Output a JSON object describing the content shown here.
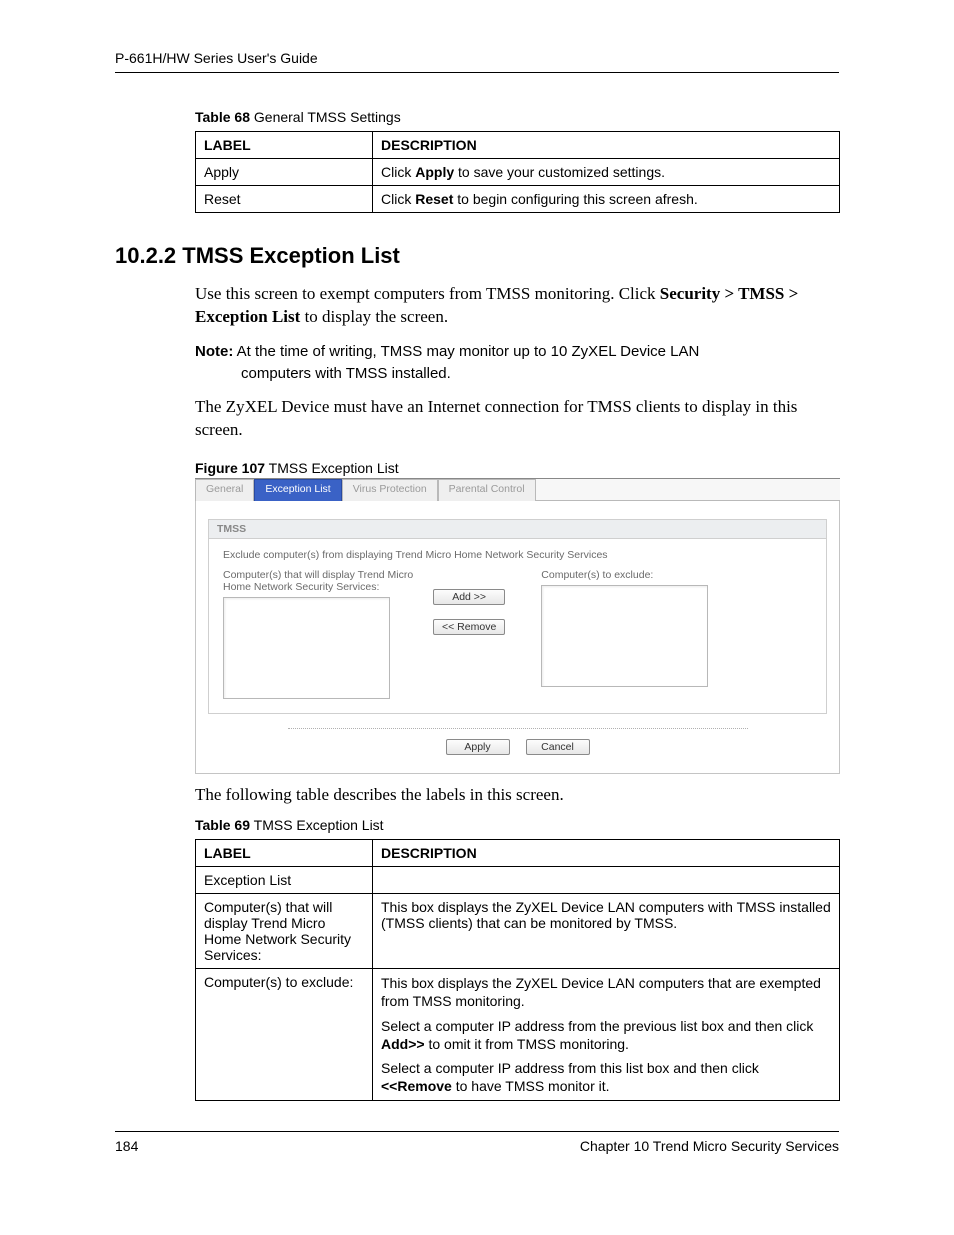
{
  "running_head": "P-661H/HW Series User's Guide",
  "table68": {
    "caption_bold": "Table 68",
    "caption_rest": "   General TMSS Settings",
    "h_label": "LABEL",
    "h_desc": "DESCRIPTION",
    "r1_label": "Apply",
    "r1_pre": "Click ",
    "r1_bold": "Apply",
    "r1_post": " to save your customized settings.",
    "r2_label": "Reset",
    "r2_pre": "Click ",
    "r2_bold": "Reset",
    "r2_post": " to begin configuring this screen afresh."
  },
  "section": {
    "heading": "10.2.2  TMSS Exception List",
    "p1_a": "Use this screen to exempt computers from TMSS monitoring. Click ",
    "p1_b": "Security > TMSS > Exception List",
    "p1_c": " to display the screen.",
    "note_bold": "Note:",
    "note_rest_line1": " At the time of writing, TMSS may monitor up to 10 ZyXEL Device LAN",
    "note_rest_line2": "computers with TMSS installed.",
    "p2": "The ZyXEL Device must have an Internet connection for TMSS clients to display in this screen.",
    "p3": "The following table describes the labels in this screen."
  },
  "fig107": {
    "caption_bold": "Figure 107",
    "caption_rest": "   TMSS Exception List",
    "tabs": {
      "general": "General",
      "exception": "Exception List",
      "virus": "Virus Protection",
      "parental": "Parental Control"
    },
    "panel_title": "TMSS",
    "instr": "Exclude computer(s) from displaying Trend Micro Home Network Security Services",
    "left_label_l1": "Computer(s) that will display Trend Micro",
    "left_label_l2": "Home Network Security Services:",
    "right_label": "Computer(s) to exclude:",
    "btn_add": "Add >>",
    "btn_remove": "<< Remove",
    "btn_apply": "Apply",
    "btn_cancel": "Cancel"
  },
  "table69": {
    "caption_bold": "Table 69",
    "caption_rest": "   TMSS Exception List",
    "h_label": "LABEL",
    "h_desc": "DESCRIPTION",
    "r1_label": "Exception List",
    "r2_label": "Computer(s) that will display Trend Micro Home Network Security Services:",
    "r2_desc": "This box displays the ZyXEL Device LAN computers with TMSS installed (TMSS clients) that can be monitored by TMSS.",
    "r3_label": "Computer(s) to exclude:",
    "r3_p1": "This box displays the ZyXEL Device LAN computers that are exempted from TMSS monitoring.",
    "r3_p2a": "Select a computer IP address from the previous list box and then click ",
    "r3_p2b": "Add>>",
    "r3_p2c": " to omit it from TMSS monitoring.",
    "r3_p3a": "Select a computer IP address from this list box and then click ",
    "r3_p3b": "<<Remove",
    "r3_p3c": " to have TMSS monitor it."
  },
  "footer": {
    "page": "184",
    "chapter": "Chapter 10 Trend Micro Security Services"
  }
}
